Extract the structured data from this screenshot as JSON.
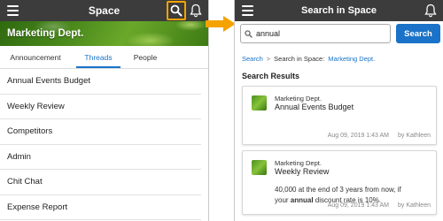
{
  "left": {
    "header": {
      "title": "Space"
    },
    "banner": {
      "title": "Marketing Dept."
    },
    "tabs": [
      {
        "label": "Announcement",
        "active": false
      },
      {
        "label": "Threads",
        "active": true
      },
      {
        "label": "People",
        "active": false
      }
    ],
    "threads": [
      "Annual Events Budget",
      "Weekly Review",
      "Competitors",
      "Admin",
      "Chit Chat",
      "Expense Report"
    ]
  },
  "right": {
    "header": {
      "title": "Search in Space"
    },
    "search": {
      "query": "annual",
      "button_label": "Search"
    },
    "breadcrumb": {
      "root": "Search",
      "prefix": "Search in Space:",
      "space": "Marketing Dept."
    },
    "results_heading": "Search Results",
    "results": [
      {
        "space": "Marketing Dept.",
        "title": "Annual Events Budget",
        "date": "Aug 09, 2019 1:43 AM",
        "author": "by Kathleen"
      },
      {
        "space": "Marketing Dept.",
        "title": "Weekly Review",
        "snippet_line1": "40,000 at the end of 3 years from now, if",
        "snippet_before": "your ",
        "snippet_highlight": "annual",
        "snippet_after": " discount rate is 10%.",
        "date": "Aug 09, 2019 1:43 AM",
        "author": "by Kathleen"
      }
    ]
  },
  "colors": {
    "accent": "#1a73c8",
    "highlight": "#f4a300",
    "topbar": "#3c3c3c"
  },
  "icons": [
    "menu-icon",
    "search-icon",
    "bell-icon",
    "arrow-right-icon",
    "thumbnail-icon"
  ]
}
